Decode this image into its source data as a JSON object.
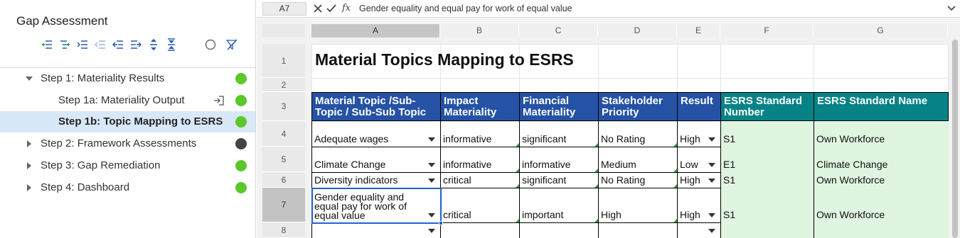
{
  "sidebar": {
    "title": "Gap Assessment",
    "toolbar": {
      "icons": [
        "add-sibling-icon",
        "add-child-icon",
        "indent-icon",
        "outdent-icon",
        "move-up-level-icon",
        "move-down-level-icon",
        "expand-all-icon",
        "collapse-all-icon",
        "circle-icon",
        "clear-filter-icon"
      ]
    },
    "items": [
      {
        "label": "Step 1: Materiality Results",
        "status": "#5cc72a",
        "expanded": true
      },
      {
        "label": "Step 1a: Materiality Output",
        "status": "#5cc72a"
      },
      {
        "label": "Step 1b: Topic Mapping to ESRS",
        "status": "#5cc72a",
        "selected": true
      },
      {
        "label": "Step 2: Framework Assessments",
        "status": "#444444"
      },
      {
        "label": "Step 3: Gap Remediation",
        "status": "#5cc72a"
      },
      {
        "label": "Step 4: Dashboard",
        "status": "#5cc72a"
      }
    ]
  },
  "formula_bar": {
    "cell_ref": "A7",
    "fx": "fx",
    "formula": "Gender equality and equal pay for work of equal value"
  },
  "sheet": {
    "columns": [
      "A",
      "B",
      "C",
      "D",
      "E",
      "F",
      "G"
    ],
    "active_column": "A",
    "rows": [
      "1",
      "2",
      "3",
      "4",
      "5",
      "6",
      "7",
      "8"
    ],
    "active_row": "7",
    "title": "Material Topics Mapping to ESRS",
    "headers": [
      "Material Topic /Sub-Topic / Sub-Sub Topic",
      "Impact Materiality",
      "Financial Materiality",
      "Stakeholder Priority",
      "Result",
      "ESRS Standard Number",
      "ESRS Standard Name"
    ],
    "data": [
      [
        "Adequate wages",
        "informative",
        "significant",
        "No Rating",
        "High",
        "S1",
        "Own Workforce"
      ],
      [
        "Climate Change",
        "informative",
        "informative",
        "Medium",
        "Low",
        "E1",
        "Climate Change"
      ],
      [
        "Diversity indicators",
        "critical",
        "significant",
        "No Rating",
        "High",
        "S1",
        "Own Workforce"
      ],
      [
        "Gender equality and equal pay for work of equal value",
        "critical",
        "important",
        "High",
        "High",
        "S1",
        "Own Workforce"
      ]
    ],
    "colors": {
      "header_blue": "#2552a4",
      "header_teal": "#078387",
      "esrs_fill": "#dff5df",
      "selection": "#1f62d1"
    }
  }
}
